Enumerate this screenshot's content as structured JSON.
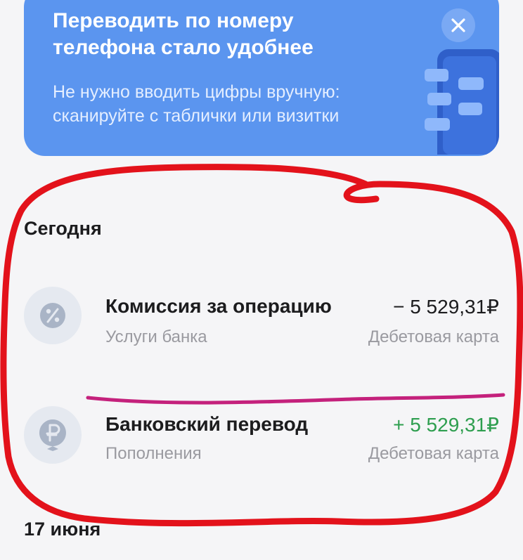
{
  "banner": {
    "title": "Переводить по номеру телефона стало удобнее",
    "text": "Не нужно вводить цифры вручную: сканируйте с таблички или визитки",
    "close_icon": "close-icon"
  },
  "sections": [
    {
      "header": "Сегодня",
      "transactions": [
        {
          "icon": "percent-icon",
          "title": "Комиссия за операцию",
          "category": "Услуги банка",
          "amount": "− 5 529,31₽",
          "account": "Дебетовая карта",
          "amount_color": "#1c1c1e"
        },
        {
          "icon": "ruble-icon",
          "title": "Банковский перевод",
          "category": "Пополнения",
          "amount": "+ 5 529,31₽",
          "account": "Дебетовая карта",
          "amount_color": "#2e9e4f"
        }
      ]
    },
    {
      "header": "17 июня",
      "transactions": []
    }
  ],
  "colors": {
    "banner_bg": "#5b95ef",
    "positive_amount": "#2e9e4f",
    "annotation_red": "#e3121b",
    "annotation_magenta": "#c4217c"
  }
}
